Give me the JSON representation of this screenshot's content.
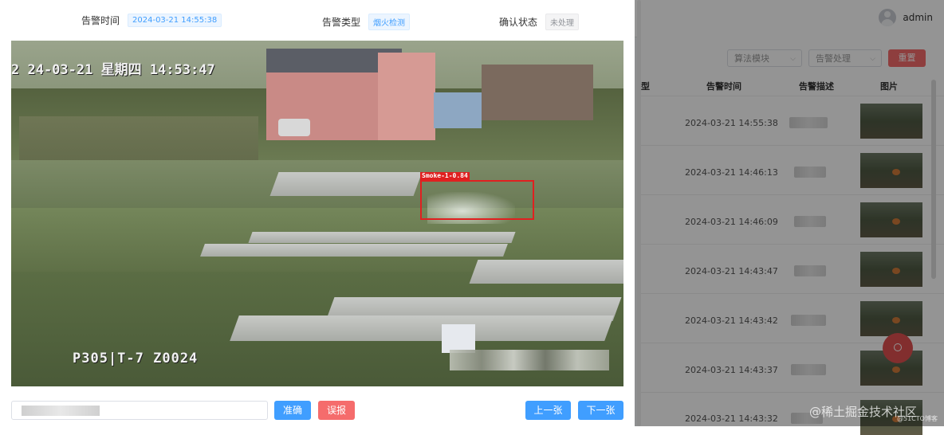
{
  "header": {
    "username": "admin"
  },
  "filters": {
    "algorithm_placeholder": "算法模块",
    "process_placeholder": "告警处理",
    "reset_label": "重置"
  },
  "table": {
    "columns": [
      "型",
      "告警时间",
      "告警描述",
      "图片"
    ],
    "rows": [
      {
        "time": "2024-03-21 14:55:38"
      },
      {
        "time": "2024-03-21 14:46:13"
      },
      {
        "time": "2024-03-21 14:46:09"
      },
      {
        "time": "2024-03-21 14:43:47"
      },
      {
        "time": "2024-03-21 14:43:42"
      },
      {
        "time": "2024-03-21 14:43:37"
      },
      {
        "time": "2024-03-21 14:43:32"
      }
    ]
  },
  "dialog": {
    "alarm_time_label": "告警时间",
    "alarm_time_value": "2024-03-21 14:55:38",
    "alarm_type_label": "告警类型",
    "alarm_type_value": "烟火检测",
    "confirm_status_label": "确认状态",
    "confirm_status_value": "未处理",
    "camera": {
      "osd_datetime": "2 24-03-21  星期四  14:53:47",
      "osd_channel": "P305|T-7   Z0024",
      "detection_label": "Smoke-1-0.84"
    },
    "buttons": {
      "accurate": "准确",
      "false_alarm": "误报",
      "prev": "上一张",
      "next": "下一张"
    }
  },
  "watermark": {
    "main": "@稀土掘金技术社区",
    "sub": "@51CTO博客"
  },
  "colors": {
    "primary": "#409eff",
    "danger": "#f56c6c",
    "detection_box": "#e02020"
  }
}
